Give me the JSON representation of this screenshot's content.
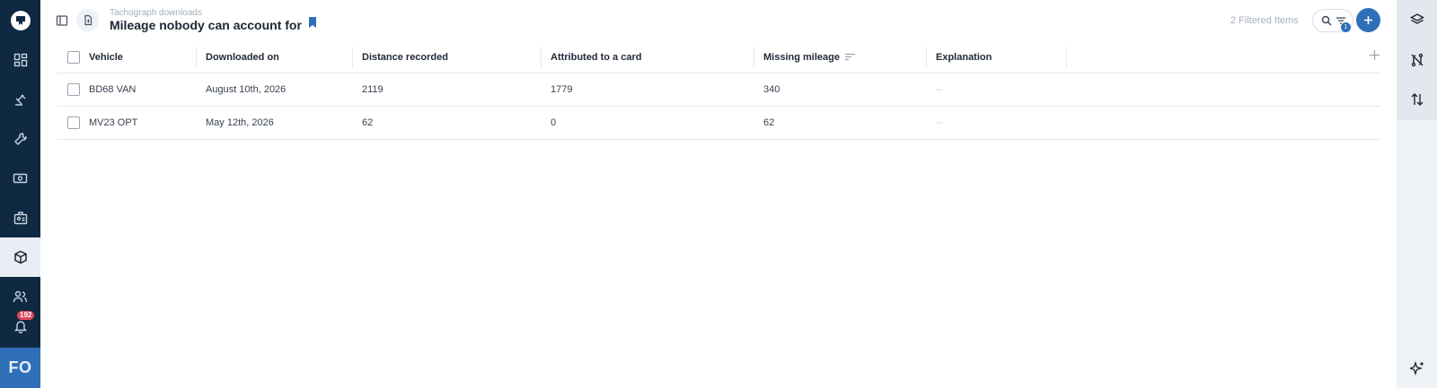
{
  "app": {
    "breadcrumb": "Tachograph downloads",
    "title": "Mileage nobody can account for",
    "filtered_items": "2 Filtered Items",
    "filter_count": "1",
    "notifications_badge": "192",
    "user_initials": "FO",
    "accent_color": "#2e6fb8",
    "nav_bg": "#0f2942"
  },
  "nav": {
    "items": [
      {
        "icon": "dashboard-icon"
      },
      {
        "icon": "gavel-icon"
      },
      {
        "icon": "wrench-icon"
      },
      {
        "icon": "money-icon"
      },
      {
        "icon": "id-card-icon"
      },
      {
        "icon": "cube-icon",
        "active": true
      },
      {
        "icon": "people-icon"
      },
      {
        "icon": "bell-icon"
      }
    ]
  },
  "table": {
    "columns": [
      "Vehicle",
      "Downloaded on",
      "Distance recorded",
      "Attributed to a card",
      "Missing mileage",
      "Explanation"
    ],
    "rows": [
      {
        "vehicle": "BD68 VAN",
        "downloaded": "August 10th, 2026",
        "distance": "2119",
        "attributed": "1779",
        "missing": "340",
        "explanation": "--"
      },
      {
        "vehicle": "MV23 OPT",
        "downloaded": "May 12th, 2026",
        "distance": "62",
        "attributed": "0",
        "missing": "62",
        "explanation": "--"
      }
    ]
  }
}
